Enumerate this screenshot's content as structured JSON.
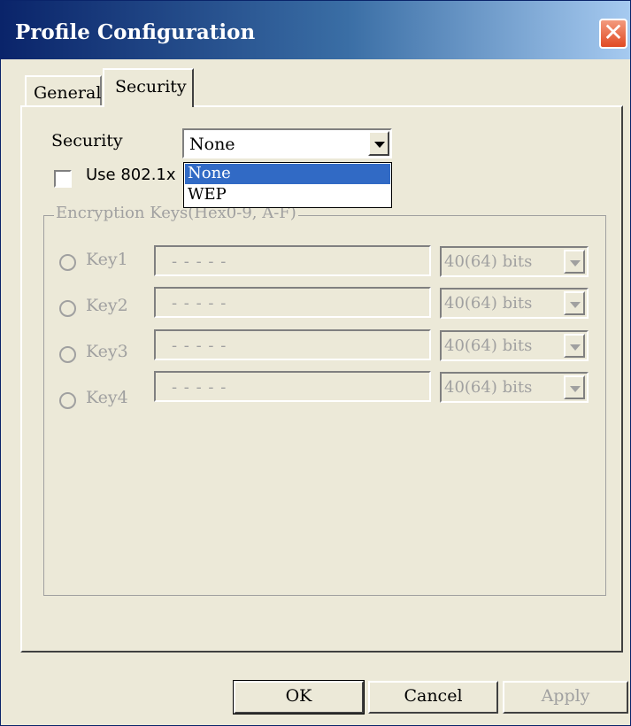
{
  "window": {
    "title": "Profile Configuration",
    "close_glyph": "✕"
  },
  "tabs": [
    {
      "label": "General"
    },
    {
      "label": "Security",
      "selected": true
    }
  ],
  "security": {
    "label": "Security",
    "selected": "None",
    "options": [
      "None",
      "WEP"
    ]
  },
  "use8021x": {
    "label": "Use 802.1x",
    "checked": false
  },
  "encryption": {
    "group_title": "Encryption Keys(Hex0-9, A-F)",
    "keys": [
      {
        "label": "Key1",
        "value": "- - - - -",
        "bits": "40(64) bits"
      },
      {
        "label": "Key2",
        "value": "- - - - -",
        "bits": "40(64) bits"
      },
      {
        "label": "Key3",
        "value": "- - - - -",
        "bits": "40(64) bits"
      },
      {
        "label": "Key4",
        "value": "- - - - -",
        "bits": "40(64) bits"
      }
    ]
  },
  "buttons": {
    "ok": "OK",
    "cancel": "Cancel",
    "apply": "Apply"
  },
  "colors": {
    "title_gradient_start": "#0a246a",
    "title_gradient_end": "#a6caf0",
    "selection": "#316ac5",
    "disabled_text": "#a0a0a0",
    "face": "#ece9d8"
  }
}
